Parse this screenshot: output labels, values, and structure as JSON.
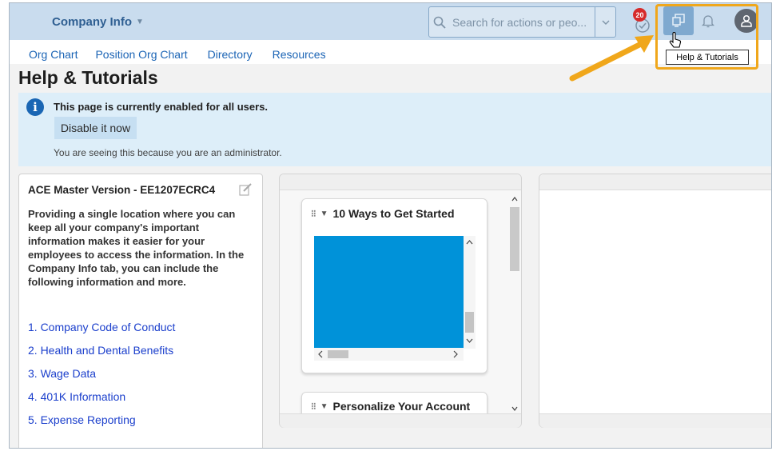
{
  "header": {
    "module_label": "Company Info",
    "search_placeholder": "Search for actions or peo...",
    "notification_count": "20",
    "tooltip": "Help & Tutorials"
  },
  "nav": {
    "items": [
      {
        "label": "Org Chart"
      },
      {
        "label": "Position Org Chart"
      },
      {
        "label": "Directory"
      },
      {
        "label": "Resources"
      }
    ]
  },
  "page": {
    "title": "Help & Tutorials"
  },
  "banner": {
    "message": "This page is currently enabled for all users.",
    "button_label": "Disable it now",
    "admin_note": "You are seeing this because you are an administrator."
  },
  "left_card": {
    "title": "ACE Master Version - EE1207ECRC4",
    "description": "Providing a single location where you can keep all your company's important information makes it easier for your employees to access the information.  In the Company Info tab, you can include the following information and more.",
    "items": [
      {
        "label": "1.  Company Code of Conduct"
      },
      {
        "label": "2.  Health and Dental Benefits"
      },
      {
        "label": "3.  Wage Data"
      },
      {
        "label": "4.  401K Information"
      },
      {
        "label": "5.  Expense Reporting"
      }
    ]
  },
  "widgets": {
    "getting_started": {
      "title": "10 Ways to Get Started"
    },
    "personalize": {
      "title": "Personalize Your Account"
    }
  },
  "colors": {
    "header_bg": "#c9dcee",
    "highlight": "#f0a71b",
    "video": "#0092d9",
    "link": "#1b64b5"
  },
  "icons": {
    "search": "search-icon",
    "notifications": "todo-icon",
    "help": "help-tutorials-icon",
    "bell": "bell-icon",
    "avatar": "user-avatar-icon",
    "info": "info-icon",
    "edit": "edit-icon"
  }
}
